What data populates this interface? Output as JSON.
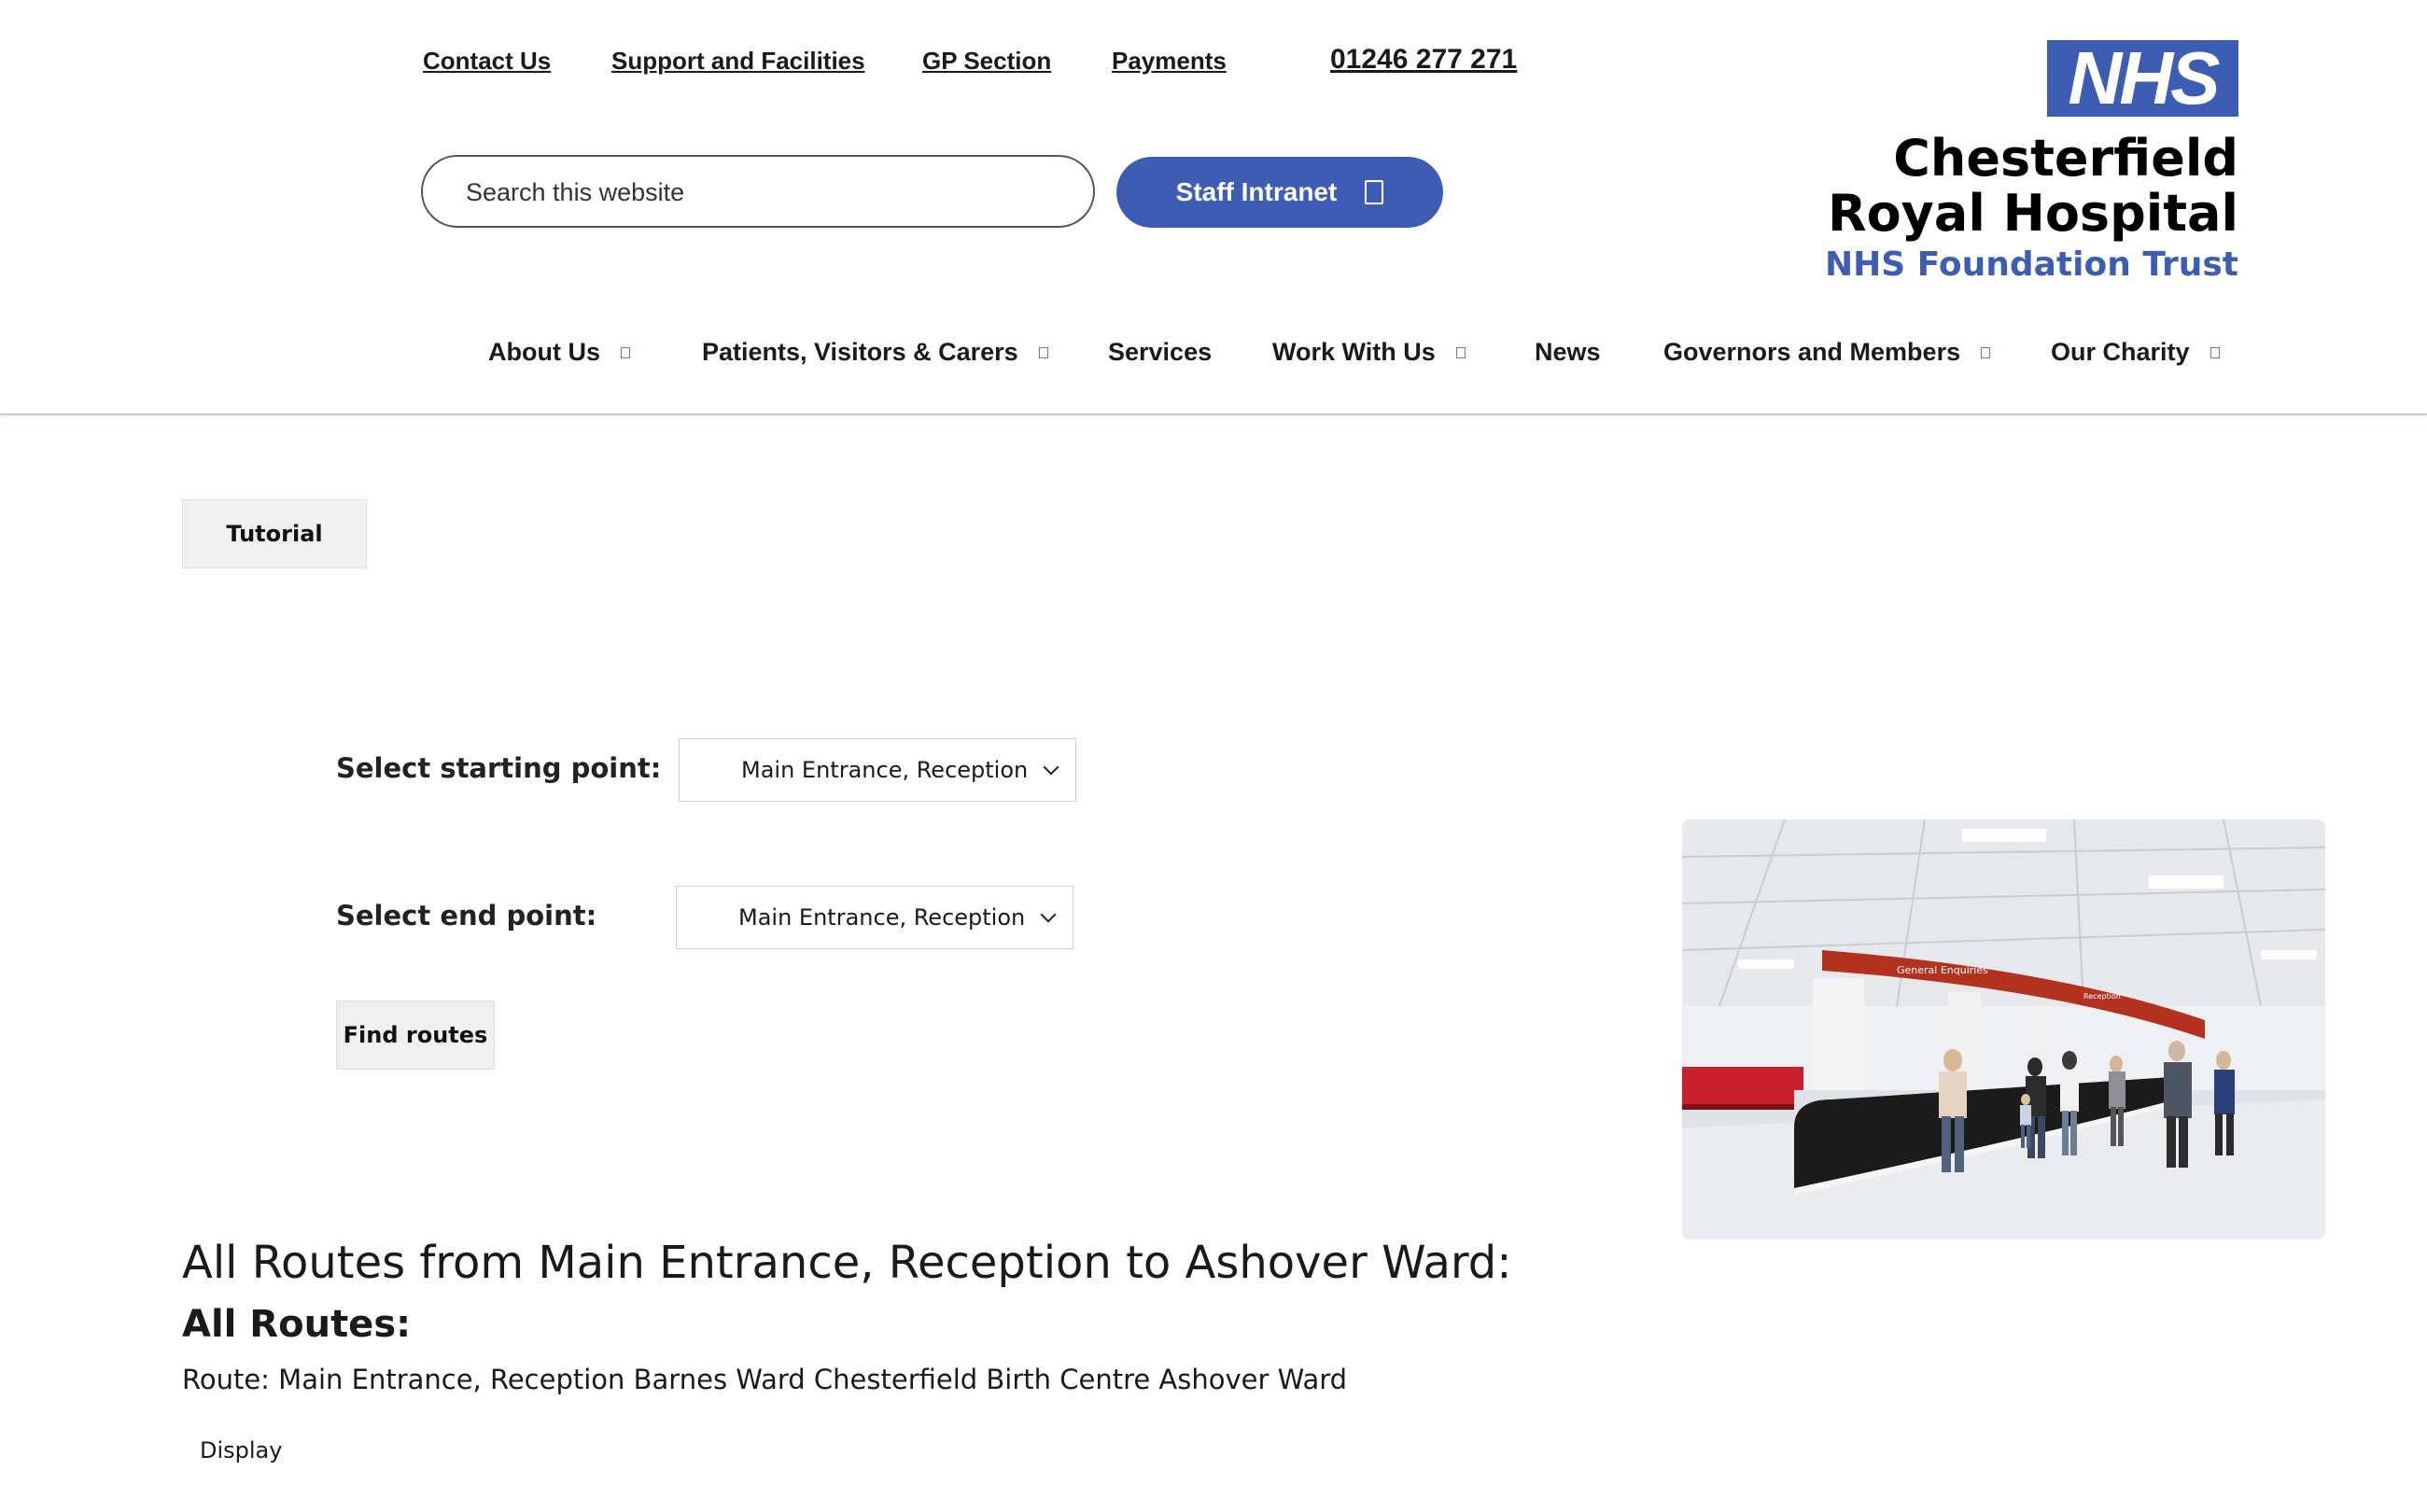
{
  "header": {
    "top_links": [
      "Contact Us",
      "Support and Facilities",
      "GP Section",
      "Payments"
    ],
    "phone": "01246 277 271",
    "search": {
      "placeholder": "Search this website"
    },
    "staff_intranet_label": "Staff Intranet"
  },
  "logo": {
    "badge": "NHS",
    "line1": "Chesterfield",
    "line2": "Royal Hospital",
    "line3": "NHS Foundation Trust",
    "colors": {
      "nhs_blue": "#3d5db5",
      "text": "#000000"
    }
  },
  "nav": {
    "items": [
      {
        "label": "About Us",
        "has_dropdown": true
      },
      {
        "label": "Patients, Visitors & Carers",
        "has_dropdown": true
      },
      {
        "label": "Services",
        "has_dropdown": false
      },
      {
        "label": "Work With Us",
        "has_dropdown": true
      },
      {
        "label": "News",
        "has_dropdown": false
      },
      {
        "label": "Governors and Members",
        "has_dropdown": true
      },
      {
        "label": "Our Charity",
        "has_dropdown": true
      }
    ]
  },
  "content": {
    "tutorial_label": "Tutorial",
    "start_label": "Select starting point:",
    "start_value": "Main Entrance, Reception",
    "end_label": "Select end point:",
    "end_value": "Main Entrance, Reception",
    "find_routes_label": "Find routes",
    "results_heading": "All Routes from Main Entrance, Reception to Ashover Ward:",
    "all_routes_heading": "All Routes:",
    "route_text": "Route: Main Entrance, Reception Barnes Ward Chesterfield Birth Centre Ashover Ward",
    "display_label": "Display"
  },
  "photo": {
    "sign_text": "General Enquiries",
    "sign_text_2": "Reception"
  },
  "colors": {
    "accent": "#3d5db5",
    "button_gray": "#efefef",
    "rule": "#c7c7c7"
  }
}
